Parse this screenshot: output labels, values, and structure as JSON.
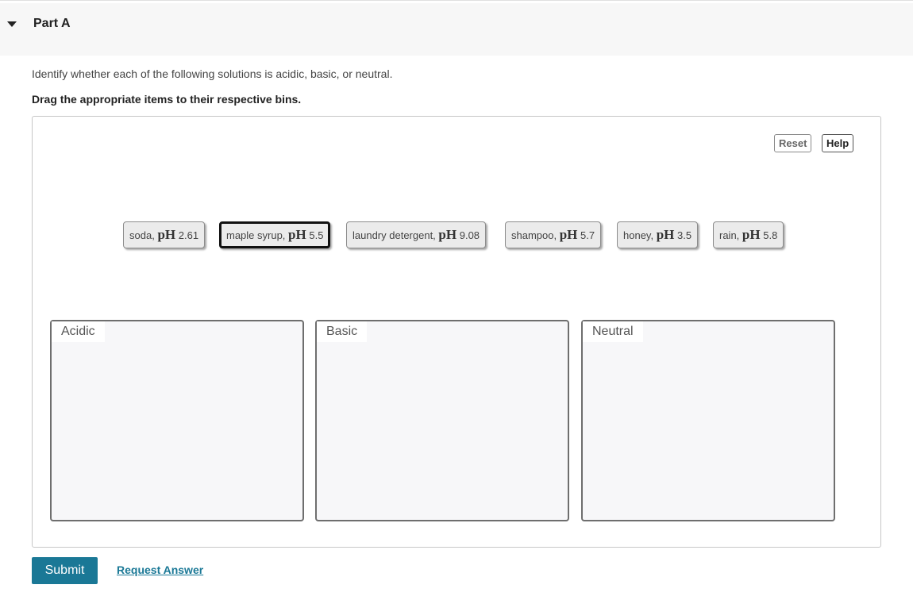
{
  "part": {
    "title": "Part A"
  },
  "question": {
    "instruction": "Identify whether each of the following solutions is acidic, basic, or neutral.",
    "directive": "Drag the appropriate items to their respective bins."
  },
  "toolbar": {
    "reset_label": "Reset",
    "help_label": "Help"
  },
  "tokens": [
    {
      "name": "soda,",
      "ph_label": "pH",
      "value": "2.61",
      "selected": false
    },
    {
      "name": "maple syrup,",
      "ph_label": "pH",
      "value": "5.5",
      "selected": true
    },
    {
      "name": "laundry detergent,",
      "ph_label": "pH",
      "value": "9.08",
      "selected": false
    },
    {
      "name": "shampoo,",
      "ph_label": "pH",
      "value": "5.7",
      "selected": false
    },
    {
      "name": "honey,",
      "ph_label": "pH",
      "value": "3.5",
      "selected": false
    },
    {
      "name": "rain,",
      "ph_label": "pH",
      "value": "5.8",
      "selected": false
    }
  ],
  "bins": [
    {
      "label": "Acidic"
    },
    {
      "label": "Basic"
    },
    {
      "label": "Neutral"
    }
  ],
  "actions": {
    "submit_label": "Submit",
    "request_label": "Request Answer"
  },
  "colors": {
    "accent": "#1a7896",
    "header_bg": "#f7f7f7",
    "bin_bg": "#f7f7f9"
  }
}
